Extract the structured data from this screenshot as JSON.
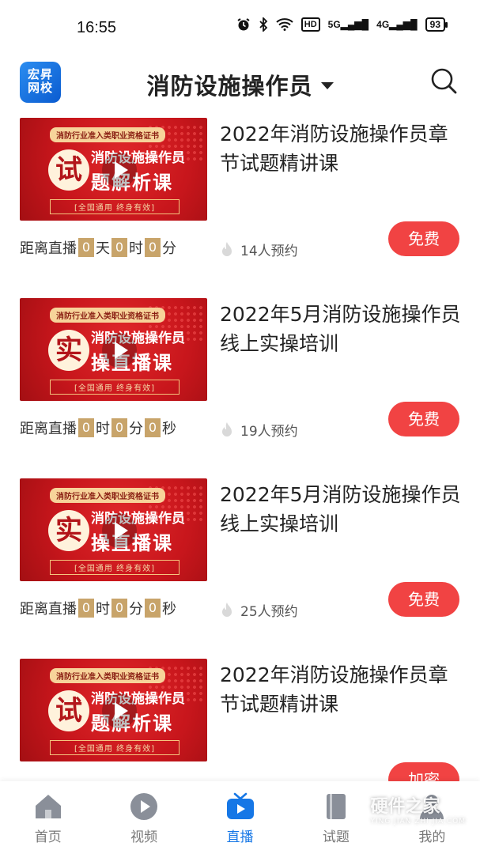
{
  "status_bar": {
    "time": "16:55",
    "hd": "HD",
    "sig1": "5G",
    "sig2": "4G",
    "battery": "93"
  },
  "header": {
    "logo_text": "宏昇网校",
    "title": "消防设施操作员",
    "icons": [
      "dropdown-caret-icon",
      "search-icon"
    ]
  },
  "courses": [
    {
      "title": "2022年消防设施操作员章节试题精讲课",
      "thumb": {
        "tag": "消防行业准入类职业资格证书",
        "big": "试",
        "line1": "消防设施操作员",
        "line2": "题解析课",
        "bottom": "[全国通用  终身有效]"
      },
      "countdown": {
        "prefix": "距离直播",
        "v1": "0",
        "u1": "天",
        "v2": "0",
        "u2": "时",
        "v3": "0",
        "u3": "分"
      },
      "reserve": "14人预约",
      "button": "免费"
    },
    {
      "title": "2022年5月消防设施操作员线上实操培训",
      "thumb": {
        "tag": "消防行业准入类职业资格证书",
        "big": "实",
        "line1": "消防设施操作员",
        "line2": "操直播课",
        "bottom": "[全国通用  终身有效]"
      },
      "countdown": {
        "prefix": "距离直播",
        "v1": "0",
        "u1": "时",
        "v2": "0",
        "u2": "分",
        "v3": "0",
        "u3": "秒"
      },
      "reserve": "19人预约",
      "button": "免费"
    },
    {
      "title": "2022年5月消防设施操作员线上实操培训",
      "thumb": {
        "tag": "消防行业准入类职业资格证书",
        "big": "实",
        "line1": "消防设施操作员",
        "line2": "操直播课",
        "bottom": "[全国通用  终身有效]"
      },
      "countdown": {
        "prefix": "距离直播",
        "v1": "0",
        "u1": "时",
        "v2": "0",
        "u2": "分",
        "v3": "0",
        "u3": "秒"
      },
      "reserve": "25人预约",
      "button": "免费"
    },
    {
      "title": "2022年消防设施操作员章节试题精讲课",
      "thumb": {
        "tag": "消防行业准入类职业资格证书",
        "big": "试",
        "line1": "消防设施操作员",
        "line2": "题解析课",
        "bottom": "[全国通用  终身有效]"
      },
      "button": "加密"
    }
  ],
  "bottom_nav": [
    {
      "label": "首页",
      "icon": "home-icon"
    },
    {
      "label": "视频",
      "icon": "video-icon"
    },
    {
      "label": "直播",
      "icon": "live-tv-icon",
      "active": true
    },
    {
      "label": "试题",
      "icon": "exam-book-icon"
    },
    {
      "label": "我的",
      "icon": "profile-icon"
    }
  ],
  "watermark": {
    "text": "硬件之家",
    "sub": "YING JIAN ZHI JIA.COM"
  },
  "colors": {
    "accent": "#1677e6",
    "button_red": "#f14343",
    "countdown_box": "#c8a46a"
  }
}
